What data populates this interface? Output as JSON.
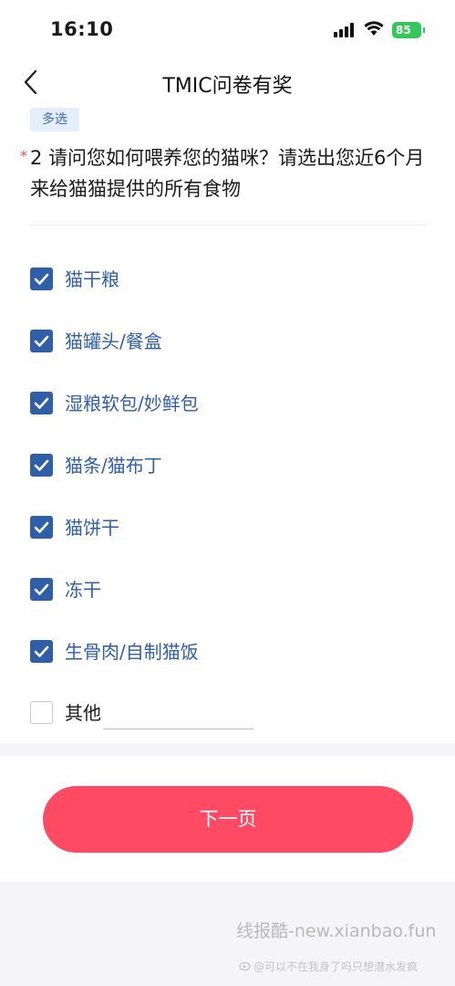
{
  "status": {
    "time": "16:10",
    "battery": "85"
  },
  "nav": {
    "title": "TMIC问卷有奖"
  },
  "question": {
    "tag": "多选",
    "required_mark": "*",
    "text": "2 请问您如何喂养您的猫咪？请选出您近6个月来给猫猫提供的所有食物"
  },
  "options": [
    {
      "label": "猫干粮",
      "checked": true
    },
    {
      "label": "猫罐头/餐盒",
      "checked": true
    },
    {
      "label": "湿粮软包/妙鲜包",
      "checked": true
    },
    {
      "label": "猫条/猫布丁",
      "checked": true
    },
    {
      "label": "猫饼干",
      "checked": true
    },
    {
      "label": "冻干",
      "checked": true
    },
    {
      "label": "生骨肉/自制猫饭",
      "checked": true
    },
    {
      "label": "其他",
      "checked": false,
      "input_value": ""
    }
  ],
  "footer": {
    "next_label": "下一页"
  },
  "watermark": {
    "site": "线报酷-new.xianbao.fun",
    "weibo": "@可以不在我身了吗只想潜水发疯"
  },
  "colors": {
    "accent": "#2f5fa8",
    "button": "#ff4a64",
    "battery": "#34c759",
    "required": "#e84a4a"
  }
}
